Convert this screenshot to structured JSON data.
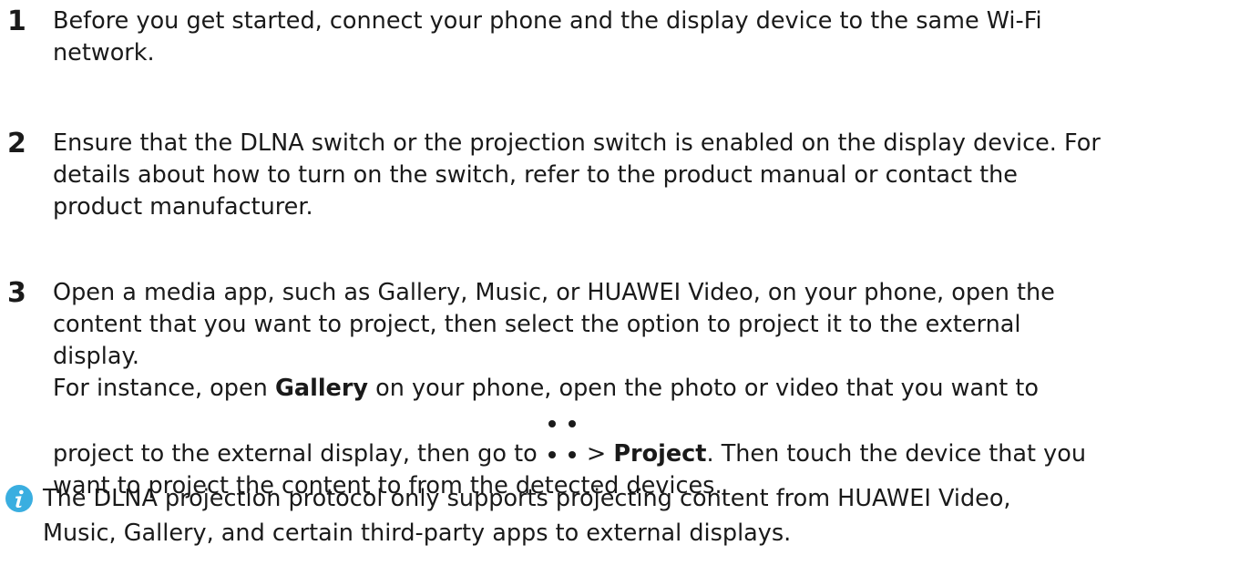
{
  "steps": [
    {
      "number": "1",
      "lines": [
        "Before you get started, connect your phone and the display device to the same Wi-Fi",
        "network."
      ]
    },
    {
      "number": "2",
      "lines": [
        "Ensure that the DLNA switch or the projection switch is enabled on the display device. For",
        "details about how to turn on the switch, refer to the product manual or contact the",
        "product manufacturer."
      ]
    },
    {
      "number": "3",
      "lines": [
        "Open a media app, such as Gallery, Music, or HUAWEI Video, on your phone, open the",
        "content that you want to project, then select the option to project it to the external",
        "display."
      ],
      "example": {
        "line1_before": "For instance, open ",
        "line1_bold": "Gallery",
        "line1_after": " on your phone, open the photo or video that you want to",
        "line2_before": "project to the external display, then go to ",
        "line2_mid": " > ",
        "line2_bold": "Project",
        "line2_after": ". Then touch the device that you",
        "line3": "want to project the content to from the detected devices."
      }
    }
  ],
  "note": {
    "icon": "info-icon",
    "icon_color": "#3aaee0",
    "lines": [
      "The DLNA projection protocol only supports projecting content from HUAWEI Video,",
      "Music, Gallery, and certain third-party apps to external displays."
    ]
  },
  "more_icon": "more-dots-icon"
}
